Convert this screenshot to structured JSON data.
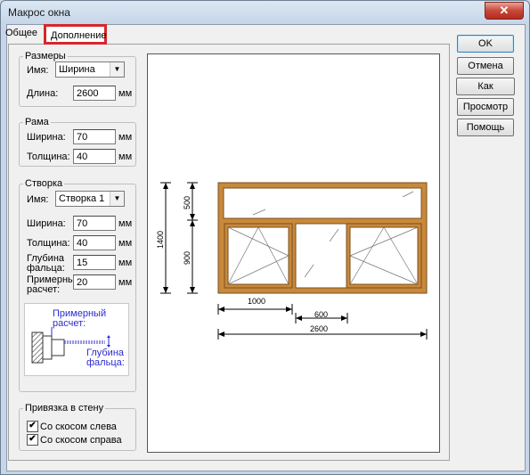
{
  "window": {
    "title": "Макрос окна",
    "close_glyph": "✕"
  },
  "tabs": {
    "general": "Общее",
    "extra": "Дополнение"
  },
  "sizes": {
    "legend": "Размеры",
    "name_label": "Имя:",
    "name_value": "Ширина",
    "length_label": "Длина:",
    "length_value": "2600",
    "unit": "мм"
  },
  "frame": {
    "legend": "Рама",
    "width_label": "Ширина:",
    "width_value": "70",
    "thickness_label": "Толщина:",
    "thickness_value": "40",
    "unit": "мм"
  },
  "sash": {
    "legend": "Створка",
    "name_label": "Имя:",
    "name_value": "Створка 1",
    "width_label": "Ширина:",
    "width_value": "70",
    "thickness_label": "Толщина:",
    "thickness_value": "40",
    "rebate_label_1": "Глубина",
    "rebate_label_2": "фальца:",
    "rebate_value": "15",
    "approx_label_1": "Примерный",
    "approx_label_2": "расчет:",
    "approx_value": "20",
    "unit": "мм"
  },
  "hint": {
    "line1": "Примерный",
    "line2": "расчет:",
    "line3": "Глубина",
    "line4": "фальца:"
  },
  "wall": {
    "legend": "Привязка в стену",
    "left_bevel": "Со скосом слева",
    "right_bevel": "Со скосом справа",
    "left_checked": true,
    "right_checked": true
  },
  "buttons": {
    "ok": "OK",
    "cancel": "Отмена",
    "as_standard": "Как Стандарт",
    "preview": "Просмотр",
    "help": "Помощь"
  },
  "drawing": {
    "dim_total_height": "1400",
    "dim_top_height": "500",
    "dim_bottom_height": "900",
    "dim_sash_width": "1000",
    "dim_middle_width": "600",
    "dim_total_width": "2600"
  },
  "colors": {
    "frame_wood": "#c8893c",
    "highlight": "#d7262e",
    "hint_text": "#2b2bd0"
  },
  "icons": {
    "checkmark": "✔",
    "dropdown": "▼"
  }
}
